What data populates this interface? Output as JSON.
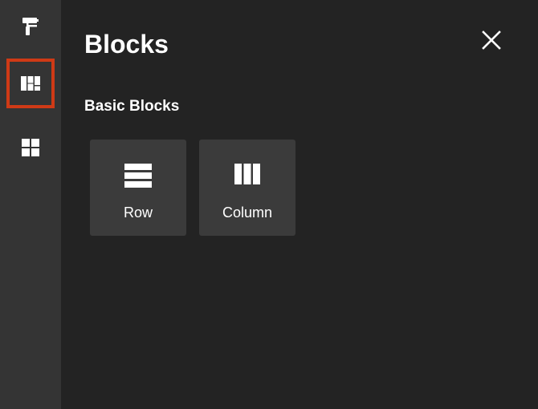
{
  "sidebar": {
    "items": [
      {
        "icon": "paint-roller-icon",
        "active": false
      },
      {
        "icon": "blocks-icon",
        "active": true
      },
      {
        "icon": "grid-icon",
        "active": false
      }
    ],
    "active_border_color": "#cf3a16"
  },
  "panel": {
    "title": "Blocks",
    "close_icon": "close-icon",
    "section_title": "Basic Blocks",
    "blocks": [
      {
        "label": "Row",
        "icon": "rows-icon"
      },
      {
        "label": "Column",
        "icon": "columns-icon"
      }
    ]
  }
}
